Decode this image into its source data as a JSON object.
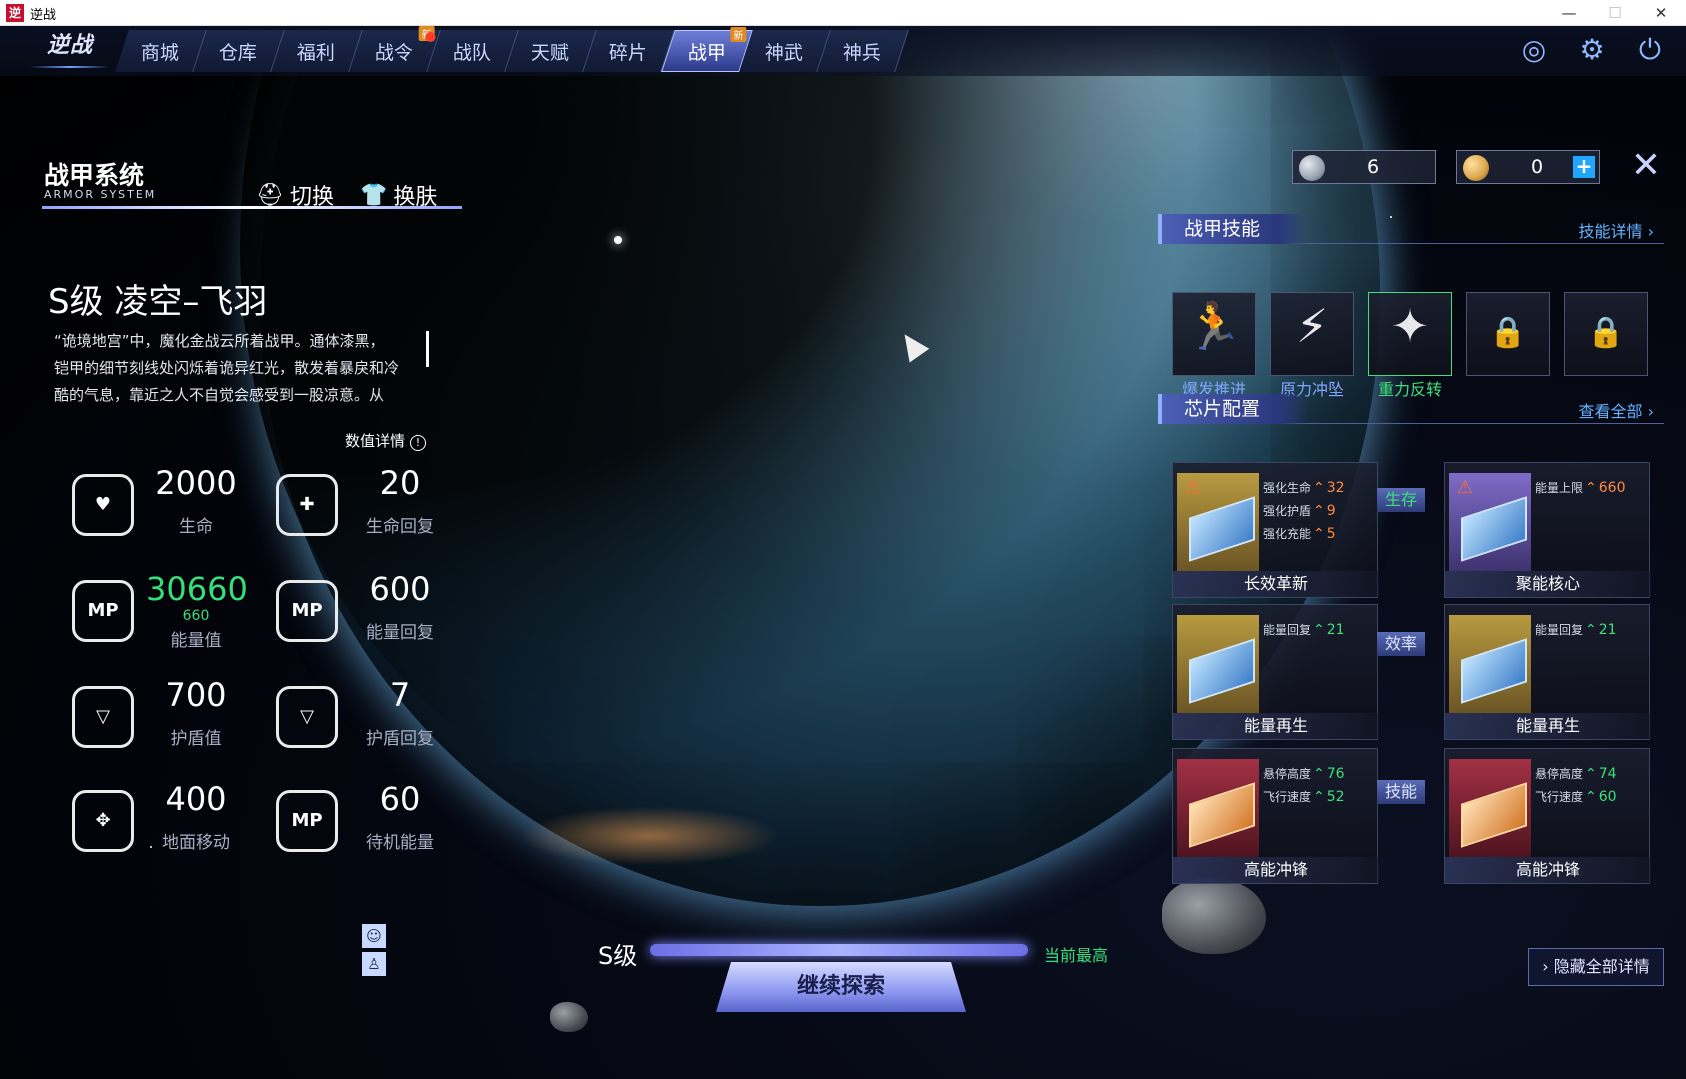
{
  "window": {
    "title": "逆战",
    "app_icon": "逆",
    "min": "—",
    "max": "☐",
    "close": "✕"
  },
  "nav": {
    "logo": "逆战",
    "tabs": [
      {
        "label": "商城"
      },
      {
        "label": "仓库"
      },
      {
        "label": "福利"
      },
      {
        "label": "战令",
        "badge": "新",
        "dot": true
      },
      {
        "label": "战队"
      },
      {
        "label": "天赋"
      },
      {
        "label": "碎片"
      },
      {
        "label": "战甲",
        "badge": "新",
        "active": true
      },
      {
        "label": "神武"
      },
      {
        "label": "神兵"
      }
    ],
    "icons": [
      "radar-icon",
      "gear-icon",
      "power-icon"
    ]
  },
  "armor": {
    "title": "战甲系统",
    "subtitle": "ARMOR SYSTEM",
    "switch_label": "切换",
    "skin_label": "换肤",
    "mech_name": "S级 凌空–飞羽",
    "desc_line1": "“诡境地宫”中，魔化金战云所着战甲。通体漆黑，",
    "desc_line2": "铠甲的细节刻线处闪烁着诡异红光，散发着暴戾和冷",
    "desc_line3": "酷的气息，靠近之人不自觉会感受到一股凉意。从",
    "detail_link": "数值详情",
    "detail_icon": "!"
  },
  "stats": [
    {
      "value": "2000",
      "label": "生命",
      "icon": "health-icon",
      "icon_text": "♥"
    },
    {
      "value": "20",
      "label": "生命回复",
      "icon": "health-regen-icon",
      "icon_text": "✚"
    },
    {
      "value": "30660",
      "bonus": "660",
      "label": "能量值",
      "icon": "energy-icon",
      "icon_text": "MP",
      "green": true
    },
    {
      "value": "600",
      "label": "能量回复",
      "icon": "energy-regen-icon",
      "icon_text": "MP"
    },
    {
      "value": "700",
      "label": "护盾值",
      "icon": "shield-icon",
      "icon_text": "▽"
    },
    {
      "value": "7",
      "label": "护盾回复",
      "icon": "shield-regen-icon",
      "icon_text": "▽"
    },
    {
      "value": "400",
      "label": "地面移动",
      "icon": "move-icon",
      "icon_text": "✥"
    },
    {
      "value": "60",
      "label": "待机能量",
      "icon": "idle-energy-icon",
      "icon_text": "MP"
    }
  ],
  "bottom": {
    "grade": "S级",
    "grade_note": "当前最高",
    "explore": "继续探索",
    "hide_details": "› 隐藏全部详情"
  },
  "currency": [
    {
      "value": "6",
      "icon": "silver-coin-icon",
      "color": "#9aa3b2"
    },
    {
      "value": "0",
      "icon": "gold-coin-icon",
      "color": "#d9a54a",
      "plus": "+"
    }
  ],
  "close_label": "✕",
  "skills": {
    "title": "战甲技能",
    "link": "技能详情 ›",
    "items": [
      {
        "label": "爆发推进",
        "glyph": "🏃",
        "icon": "burst-thrust-icon"
      },
      {
        "label": "原力冲坠",
        "glyph": "⚡",
        "icon": "force-plunge-icon"
      },
      {
        "label": "重力反转",
        "glyph": "✦",
        "icon": "gravity-flip-icon",
        "active": true
      },
      {
        "locked": true,
        "glyph": "🔒",
        "icon": "lock-icon"
      },
      {
        "locked": true,
        "glyph": "🔒",
        "icon": "lock-icon"
      }
    ]
  },
  "chips": {
    "title": "芯片配置",
    "link": "查看全部 ›",
    "links": [
      "生存",
      "效率",
      "技能"
    ],
    "items": [
      {
        "name": "长效革新",
        "color": "gold",
        "warn": "⚠",
        "stats": [
          {
            "k": "强化生命",
            "v": "32",
            "c": "o"
          },
          {
            "k": "强化护盾",
            "v": "9",
            "c": "o"
          },
          {
            "k": "强化充能",
            "v": "5",
            "c": "o"
          }
        ]
      },
      {
        "name": "聚能核心",
        "color": "purple",
        "warn": "⚠",
        "stats": [
          {
            "k": "能量上限",
            "v": "660",
            "c": "o"
          }
        ]
      },
      {
        "name": "能量再生",
        "color": "gold",
        "stats": [
          {
            "k": "能量回复",
            "v": "21",
            "c": "g"
          }
        ]
      },
      {
        "name": "能量再生",
        "color": "gold",
        "stats": [
          {
            "k": "能量回复",
            "v": "21",
            "c": "g"
          }
        ]
      },
      {
        "name": "高能冲锋",
        "color": "red",
        "orange": true,
        "stats": [
          {
            "k": "悬停高度",
            "v": "76",
            "c": "g"
          },
          {
            "k": "飞行速度",
            "v": "52",
            "c": "g"
          }
        ]
      },
      {
        "name": "高能冲锋",
        "color": "red",
        "orange": true,
        "stats": [
          {
            "k": "悬停高度",
            "v": "74",
            "c": "g"
          },
          {
            "k": "飞行速度",
            "v": "60",
            "c": "g"
          }
        ]
      }
    ]
  },
  "side_buttons": [
    "☺",
    "♙"
  ],
  "colors": {
    "accent": "#8fa3ff",
    "positive": "#3fe07c",
    "warning": "#ff8a40",
    "link": "#62b2ff"
  }
}
